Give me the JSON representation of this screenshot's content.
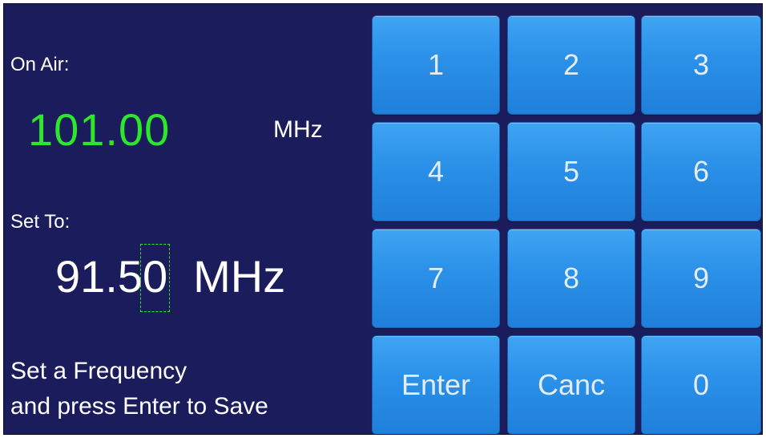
{
  "on_air": {
    "label": "On Air:",
    "value": "101.00",
    "unit": "MHz"
  },
  "set_to": {
    "label": "Set To:",
    "value_prefix": "91.5",
    "value_cursor_digit": "0",
    "unit": "MHz"
  },
  "hint": {
    "line1": "Set a Frequency",
    "line2": "and press Enter to Save"
  },
  "keypad": {
    "keys": [
      "1",
      "2",
      "3",
      "4",
      "5",
      "6",
      "7",
      "8",
      "9",
      "Enter",
      "Canc",
      "0"
    ]
  },
  "colors": {
    "background": "#1b1c5c",
    "on_air_value": "#2ce82a",
    "key": "#2a90e8",
    "text": "#ffffff"
  }
}
